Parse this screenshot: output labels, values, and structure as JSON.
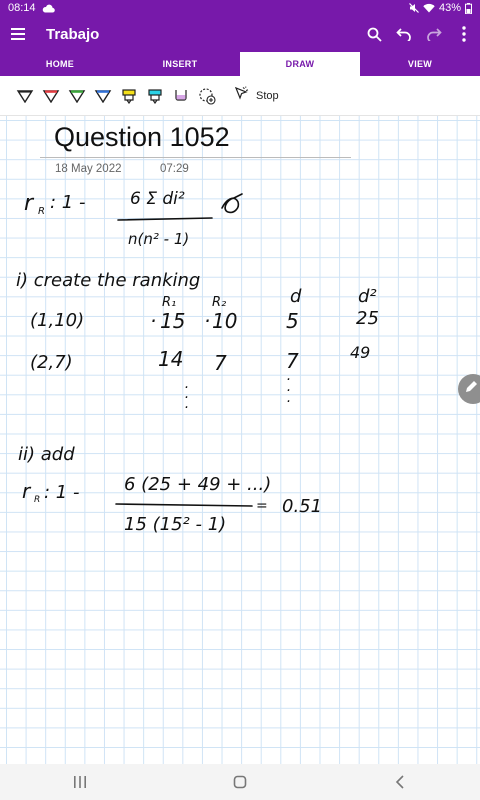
{
  "status": {
    "time": "08:14",
    "battery": "43%",
    "icons": [
      "cloud-icon",
      "mute-icon",
      "wifi-icon",
      "battery-icon"
    ]
  },
  "appbar": {
    "title": "Trabajo",
    "icons": [
      "menu-icon",
      "search-icon",
      "undo-icon",
      "redo-icon",
      "more-icon"
    ]
  },
  "tabs": [
    {
      "label": "HOME",
      "active": false
    },
    {
      "label": "INSERT",
      "active": false
    },
    {
      "label": "DRAW",
      "active": true
    },
    {
      "label": "VIEW",
      "active": false
    }
  ],
  "toolbar": {
    "pens": [
      {
        "name": "pen-black",
        "color": "#222222"
      },
      {
        "name": "pen-red",
        "color": "#e0393e"
      },
      {
        "name": "pen-green",
        "color": "#3aa53a"
      },
      {
        "name": "pen-blue",
        "color": "#2f6fd6"
      },
      {
        "name": "highlighter-yellow",
        "color": "#f5e11a"
      },
      {
        "name": "highlighter-cyan",
        "color": "#2bd2e6"
      },
      {
        "name": "highlighter-pink",
        "color": "#d7a6e6"
      }
    ],
    "stop_label": "Stop"
  },
  "page": {
    "title": "Question 1052",
    "date": "18 May 2022",
    "time": "07:29"
  },
  "ink": {
    "formula_lhs": "r",
    "formula_sub": "R",
    "formula_num": "6 Σ di²",
    "formula_den": "n(n² - 1)",
    "step1": "i) create the ranking",
    "col_r1": "R₁",
    "col_r2": "R₂",
    "col_d": "d",
    "col_d2": "d²",
    "row1_pair": "(1,10)",
    "row1_r1": "15",
    "row1_r2": "10",
    "row1_d": "5",
    "row1_d2": "25",
    "row2_pair": "(2,7)",
    "row2_r1": "14",
    "row2_r2": "7",
    "row2_d": "7",
    "row2_d2": "49",
    "step2": "ii) add",
    "final_num": "6 (25 + 49 + ...)",
    "final_den": "15 (15² - 1)",
    "final_result": "0.51"
  }
}
